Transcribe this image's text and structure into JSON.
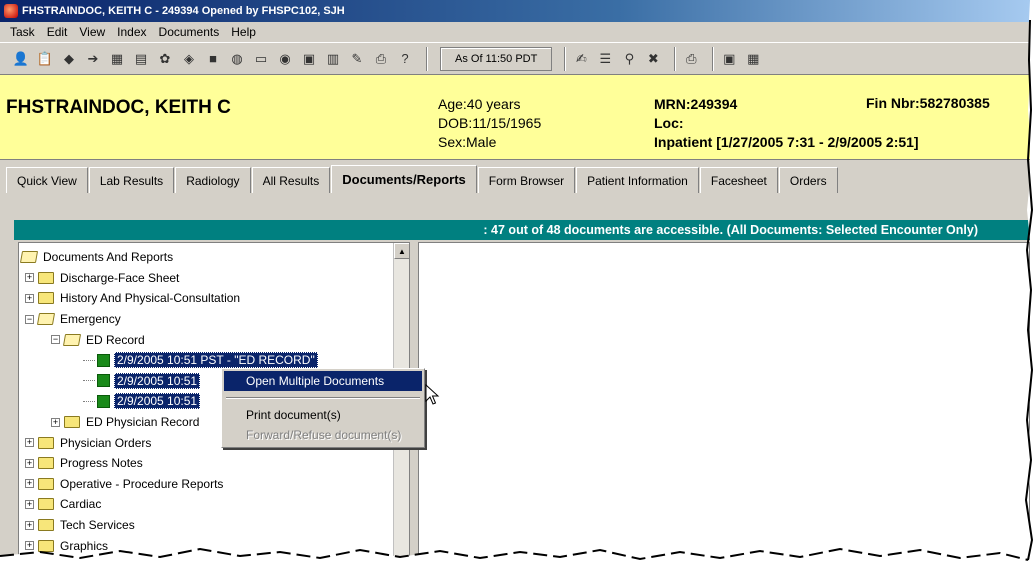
{
  "window": {
    "title": "FHSTRAINDOC, KEITH C - 249394 Opened by FHSPC102, SJH"
  },
  "menu": [
    "Task",
    "Edit",
    "View",
    "Index",
    "Documents",
    "Help"
  ],
  "toolbar": {
    "as_of": "As Of 11:50 PDT"
  },
  "patient": {
    "name": "FHSTRAINDOC, KEITH C",
    "age": "Age:40 years",
    "dob": "DOB:11/15/1965",
    "sex": "Sex:Male",
    "mrn": "MRN:249394",
    "loc": "Loc:",
    "encounter": "Inpatient [1/27/2005 7:31 - 2/9/2005 2:51]",
    "fin": "Fin Nbr:582780385"
  },
  "tabs": [
    "Quick View",
    "Lab Results",
    "Radiology",
    "All Results",
    "Documents/Reports",
    "Form Browser",
    "Patient Information",
    "Facesheet",
    "Orders"
  ],
  "status": ": 47 out of 48 documents are accessible. (All Documents: Selected Encounter Only)",
  "tree": {
    "root": "Documents And Reports",
    "items": [
      "Discharge-Face Sheet",
      "History And Physical-Consultation",
      "Emergency",
      "ED Record",
      "2/9/2005 10:51 PST  - \"ED RECORD\"",
      "2/9/2005 10:51",
      "2/9/2005 10:51",
      "ED Physician Record",
      "Physician Orders",
      "Progress Notes",
      "Operative - Procedure Reports",
      "Cardiac",
      "Tech Services",
      "Graphics"
    ]
  },
  "context_menu": {
    "open_multiple": "Open Multiple Documents",
    "print": "Print document(s)",
    "forward": "Forward/Refuse document(s)"
  },
  "colors": {
    "banner": "#ffff99",
    "status_bar": "#008080",
    "selection": "#0a246a",
    "title_bar": "#0a246a"
  }
}
